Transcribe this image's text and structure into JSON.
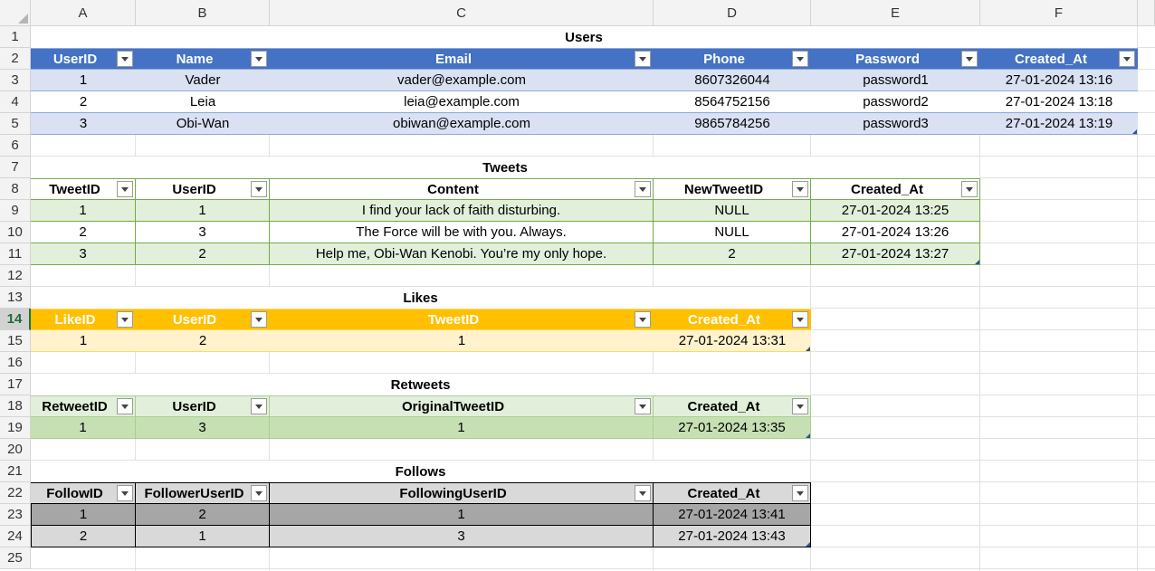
{
  "columns": [
    "A",
    "B",
    "C",
    "D",
    "E",
    "F"
  ],
  "rows": [
    "1",
    "2",
    "3",
    "4",
    "5",
    "6",
    "7",
    "8",
    "9",
    "10",
    "11",
    "12",
    "13",
    "14",
    "15",
    "16",
    "17",
    "18",
    "19",
    "20",
    "21",
    "22",
    "23",
    "24",
    "25"
  ],
  "selected_row": "14",
  "tables": [
    {
      "id": "users",
      "title": "Users",
      "title_row": 1,
      "header_row": 2,
      "headers": [
        "UserID",
        "Name",
        "Email",
        "Phone",
        "Password",
        "Created_At"
      ],
      "rows": [
        [
          "1",
          "Vader",
          "vader@example.com",
          "8607326044",
          "password1",
          "27-01-2024 13:16"
        ],
        [
          "2",
          "Leia",
          "leia@example.com",
          "8564752156",
          "password2",
          "27-01-2024 13:18"
        ],
        [
          "3",
          "Obi-Wan",
          "obiwan@example.com",
          "9865784256",
          "password3",
          "27-01-2024 13:19"
        ]
      ],
      "colors": {
        "header_bg": "#4472c4",
        "header_fg": "#ffffff",
        "band_odd": "#d9e1f2",
        "band_even": "#ffffff",
        "border": "#8ea9db"
      }
    },
    {
      "id": "tweets",
      "title": "Tweets",
      "title_row": 7,
      "header_row": 8,
      "headers": [
        "TweetID",
        "UserID",
        "Content",
        "NewTweetID",
        "Created_At"
      ],
      "rows": [
        [
          "1",
          "1",
          "I find your lack of faith disturbing.",
          "NULL",
          "27-01-2024 13:25"
        ],
        [
          "2",
          "3",
          "The Force will be with you. Always.",
          "NULL",
          "27-01-2024 13:26"
        ],
        [
          "3",
          "2",
          "Help me, Obi-Wan Kenobi. You’re my only hope.",
          "2",
          "27-01-2024 13:27"
        ]
      ],
      "colors": {
        "header_bg": "#ffffff",
        "header_fg": "#000000",
        "band_odd": "#e2efda",
        "band_even": "#ffffff",
        "border": "#70ad47"
      }
    },
    {
      "id": "likes",
      "title": "Likes",
      "title_row": 13,
      "header_row": 14,
      "headers": [
        "LikeID",
        "UserID",
        "TweetID",
        "Created_At"
      ],
      "rows": [
        [
          "1",
          "2",
          "1",
          "27-01-2024 13:31"
        ]
      ],
      "colors": {
        "header_bg": "#ffc000",
        "header_fg": "#ffffff",
        "band_odd": "#fff2cc",
        "band_even": "#ffffff",
        "border": "#ffd966"
      }
    },
    {
      "id": "retweets",
      "title": "Retweets",
      "title_row": 17,
      "header_row": 18,
      "headers": [
        "RetweetID",
        "UserID",
        "OriginalTweetID",
        "Created_At"
      ],
      "rows": [
        [
          "1",
          "3",
          "1",
          "27-01-2024 13:35"
        ]
      ],
      "colors": {
        "header_bg": "#e2efda",
        "header_fg": "#000000",
        "band_odd": "#c6e0b4",
        "band_even": "#ffffff",
        "border": "#a9d08e"
      }
    },
    {
      "id": "follows",
      "title": "Follows",
      "title_row": 21,
      "header_row": 22,
      "headers": [
        "FollowID",
        "FollowerUserID",
        "FollowingUserID",
        "Created_At"
      ],
      "rows": [
        [
          "1",
          "2",
          "1",
          "27-01-2024 13:41"
        ],
        [
          "2",
          "1",
          "3",
          "27-01-2024 13:43"
        ]
      ],
      "colors": {
        "header_bg": "#d9d9d9",
        "header_fg": "#000000",
        "band_odd": "#a6a6a6",
        "band_even": "#d9d9d9",
        "border": "#000000"
      }
    }
  ]
}
